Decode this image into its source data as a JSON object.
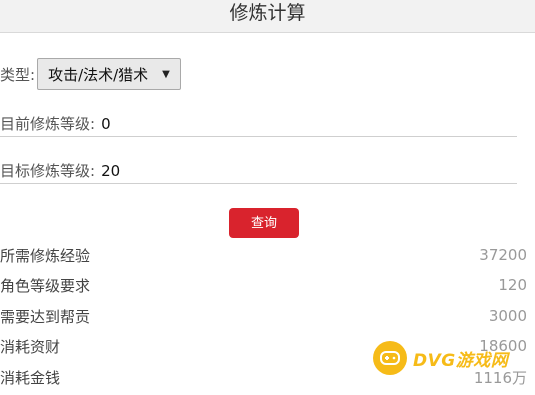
{
  "header": {
    "title": "修炼计算"
  },
  "type_select": {
    "label": "类型:",
    "selected": "攻击/法术/猎术"
  },
  "current_level": {
    "label": "目前修炼等级:",
    "value": "0"
  },
  "target_level": {
    "label": "目标修炼等级:",
    "value": "20"
  },
  "query_button": {
    "label": "查询"
  },
  "results": [
    {
      "label": "所需修炼经验",
      "value": "37200"
    },
    {
      "label": "角色等级要求",
      "value": "120"
    },
    {
      "label": "需要达到帮贡",
      "value": "3000"
    },
    {
      "label": "消耗资财",
      "value": "18600"
    },
    {
      "label": "消耗金钱",
      "value": "1116万"
    }
  ],
  "watermark": {
    "text": "DVG游戏网",
    "icon": "gamepad-icon",
    "color": "#f6b400"
  }
}
